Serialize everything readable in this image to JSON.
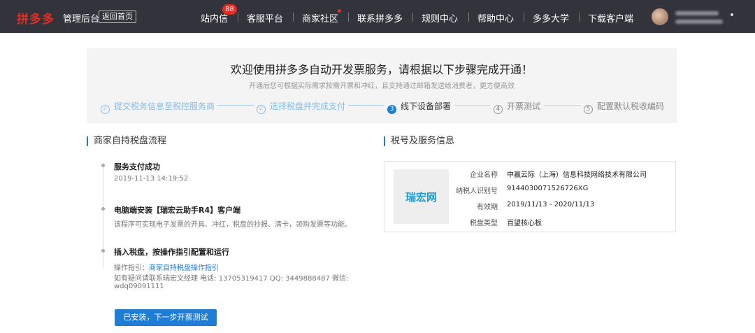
{
  "nav": {
    "brand": "拼多多",
    "brand_sub": "管理后台",
    "home_button": "返回首页",
    "items": [
      "站内信",
      "客服平台",
      "商家社区",
      "联系拼多多",
      "规则中心",
      "帮助中心",
      "多多大学",
      "下载客户端"
    ],
    "badge_count": "88"
  },
  "hero": {
    "title": "欢迎使用拼多多自动开发票服务，请根据以下步骤完成开通！",
    "subtitle": "开通后您可根据实际需求按需开票和冲红，且支持通过邮箱发送给消费者，更方便高效",
    "steps": [
      {
        "label": "提交税务信息至税控服务商",
        "state": "done",
        "marker": "✓"
      },
      {
        "label": "选择税盘并完成支付",
        "state": "done",
        "marker": "✓"
      },
      {
        "label": "线下设备部署",
        "state": "current",
        "marker": "3"
      },
      {
        "label": "开票测试",
        "state": "todo",
        "marker": "4"
      },
      {
        "label": "配置默认税收编码",
        "state": "todo",
        "marker": "5"
      }
    ]
  },
  "process": {
    "heading": "商家自持税盘流程",
    "items": [
      {
        "title": "服务支付成功",
        "lines": [
          "2019-11-13  14:19:52"
        ]
      },
      {
        "title": "电脑端安装【瑞宏云助手R4】客户端",
        "lines": [
          "该程序可实现电子发票的开具、冲红，税盘的抄报、清卡，领购发票等功能。"
        ]
      },
      {
        "title": "插入税盘，按操作指引配置和运行",
        "guide_label": "操作指引：",
        "guide_link": "商家自持税盘操作指引",
        "lines": [
          "如有疑问请联系瑞宏文经理 电话: 13705319417 QQ: 3449888487 微信:",
          "wdq09091111"
        ]
      }
    ],
    "button": "已安装，下一步开票测试"
  },
  "taxinfo": {
    "heading": "税号及服务信息",
    "logo_text": "瑞宏网",
    "rows": [
      {
        "label": "企业名称",
        "value": "中嬴云际（上海）信息科技网络技术有限公司"
      },
      {
        "label": "纳税人识别号",
        "value": "9144030071526726XG"
      },
      {
        "label": "有效期",
        "value": "2019/11/13 - 2020/11/13"
      },
      {
        "label": "税盘类型",
        "value": "百望核心板"
      }
    ]
  },
  "colors": {
    "brand": "#e02e24",
    "accent": "#1f7dd6",
    "nav_bg": "#33333b"
  }
}
